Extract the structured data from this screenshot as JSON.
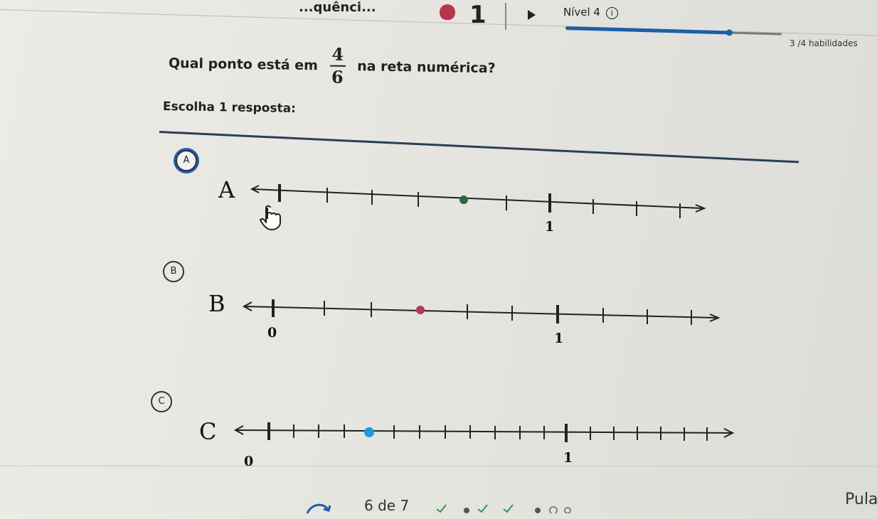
{
  "header": {
    "title": "...quênci...",
    "streak_count": "1",
    "level_label": "Nível 4",
    "info_glyph": "i",
    "progress_fraction": 0.76,
    "skills_label": "3 /4 habilidades"
  },
  "question": {
    "prefix": "Qual ponto está em",
    "fraction_numerator": "4",
    "fraction_denominator": "6",
    "suffix": "na reta numérica?",
    "instruction": "Escolha 1 resposta:"
  },
  "choices": [
    {
      "id": "A",
      "circle_label": "A",
      "line_letter": "A",
      "selected": true,
      "zero_label": "",
      "one_label": "1",
      "point_color": "#2b6a3a"
    },
    {
      "id": "B",
      "circle_label": "B",
      "line_letter": "B",
      "selected": false,
      "zero_label": "0",
      "one_label": "1",
      "point_color": "#b03a5b"
    },
    {
      "id": "C",
      "circle_label": "C",
      "line_letter": "C",
      "selected": false,
      "zero_label": "0",
      "one_label": "1",
      "point_color": "#1e9ad6"
    }
  ],
  "footer": {
    "counter": "6 de 7",
    "skip_label": "Pula"
  },
  "colors": {
    "accent": "#1b5fa8",
    "streak": "#b8344a"
  }
}
